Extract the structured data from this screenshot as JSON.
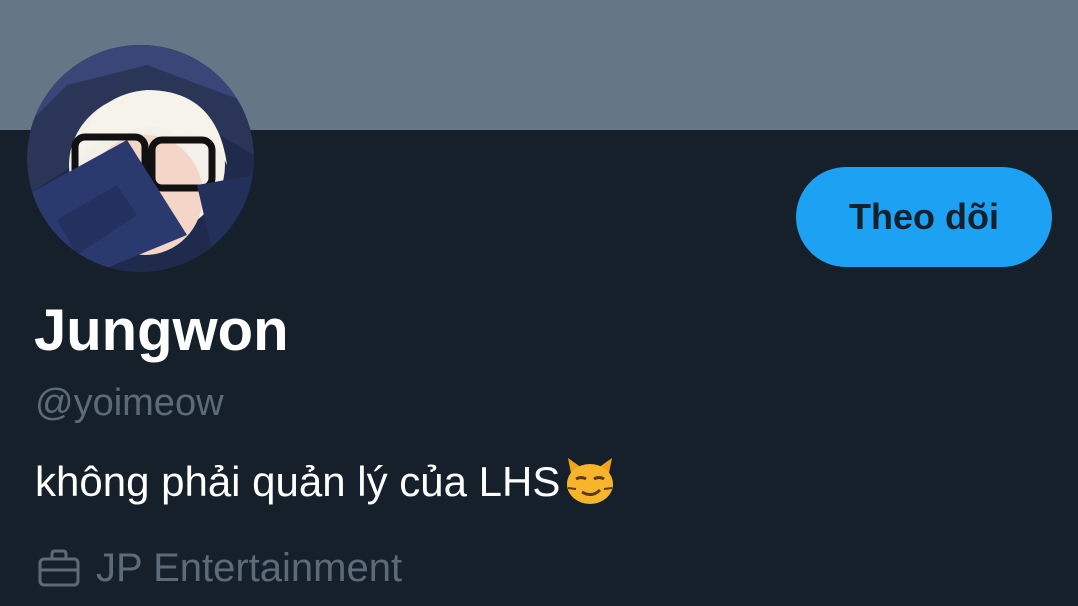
{
  "profile": {
    "display_name": "Jungwon",
    "handle": "@yoimeow",
    "bio": "không phải quản lý của LHS",
    "bio_emoji": "smirking-cat-emoji",
    "work": "JP Entertainment",
    "work_icon": "briefcase-icon"
  },
  "actions": {
    "follow_label": "Theo dõi"
  },
  "colors": {
    "background": "#15202b",
    "banner": "#657786",
    "accent": "#1da1f2",
    "muted_text": "#5d6b79",
    "primary_text": "#ffffff"
  }
}
